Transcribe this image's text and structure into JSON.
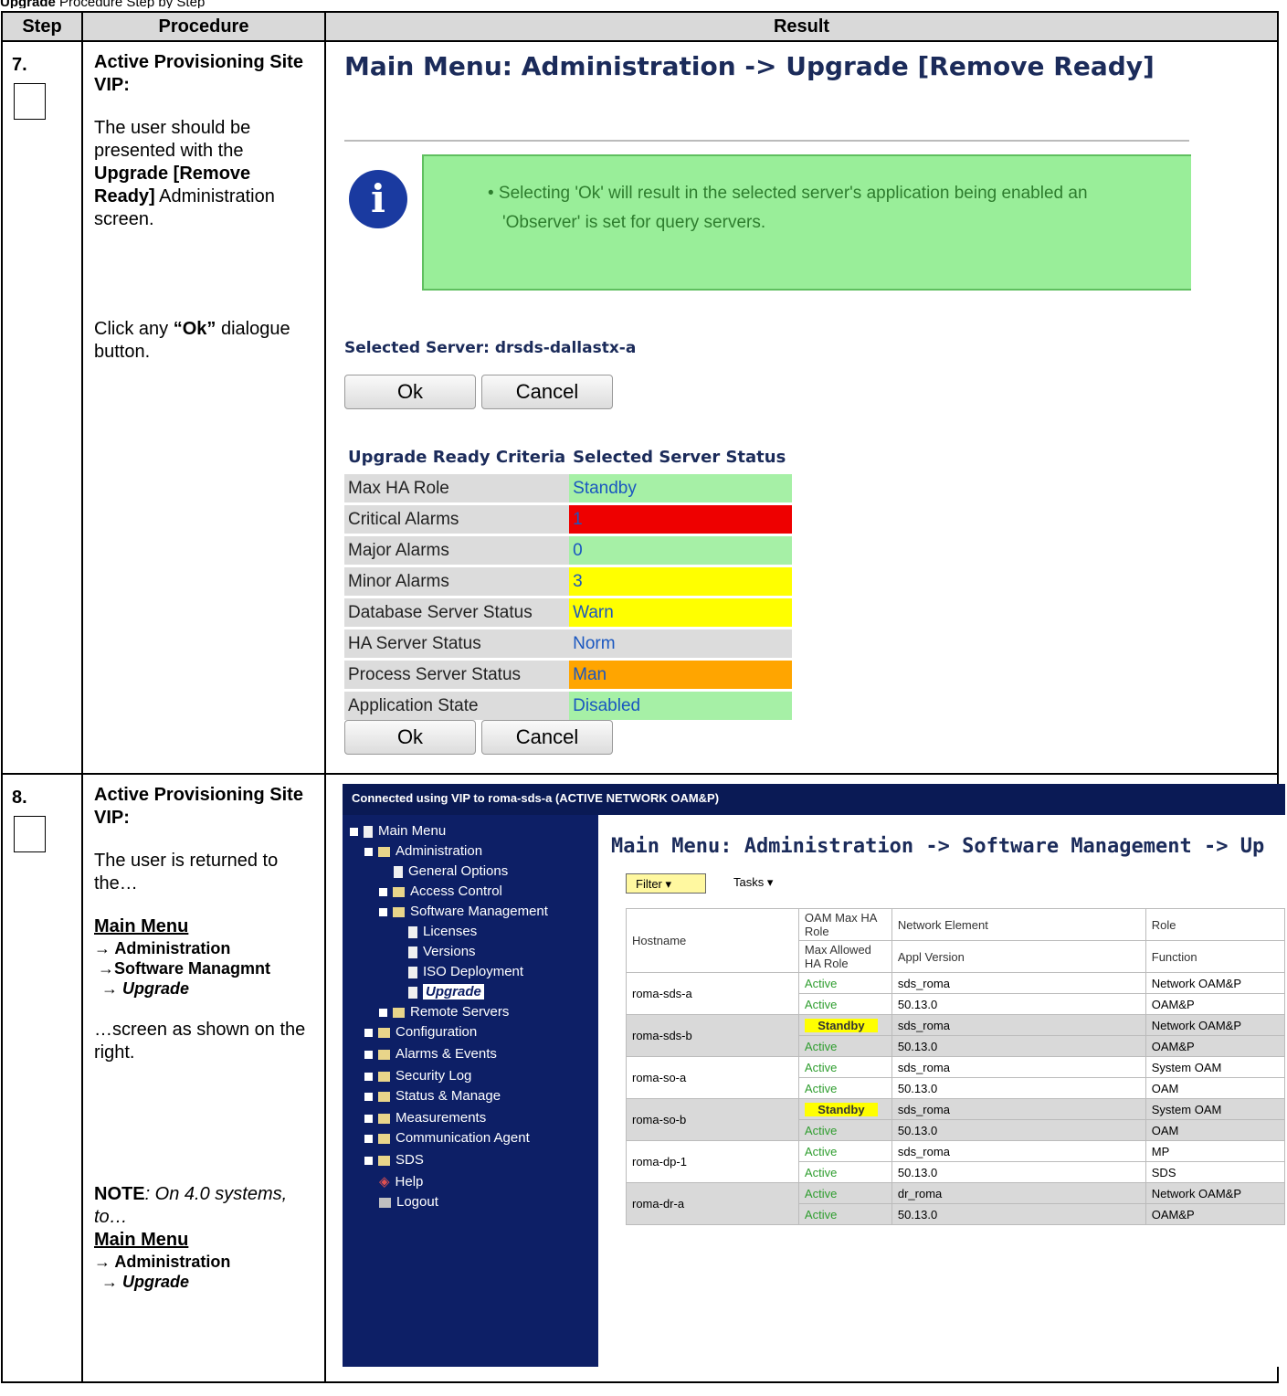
{
  "top_fragment": {
    "bold": "Upgrade",
    "rest": "Procedure Step by Step"
  },
  "headers": {
    "step": "Step",
    "procedure": "Procedure",
    "result": "Result"
  },
  "step7": {
    "number": "7.",
    "proc_heading": "Active Provisioning Site VIP:",
    "proc_p1_a": "The user should be presented with the ",
    "proc_p1_bold": "Upgrade [Remove Ready]",
    "proc_p1_b": " Administration screen.",
    "proc_p2_a": "Click any ",
    "proc_p2_bold": "“Ok”",
    "proc_p2_b": " dialogue button.",
    "title": "Main Menu: Administration -> Upgrade [Remove Ready]",
    "info_line1": "•  Selecting 'Ok' will result in the selected server's application being enabled an",
    "info_line2": "'Observer' is set for query servers.",
    "selected_server": "Selected Server: drsds-dallastx-a",
    "ok_label": "Ok",
    "cancel_label": "Cancel",
    "crit_header1": "Upgrade Ready Criteria",
    "crit_header2": "Selected Server Status",
    "criteria": [
      {
        "label": "Max HA Role",
        "value": "Standby",
        "color": "#a6f0a6"
      },
      {
        "label": "Critical Alarms",
        "value": "1",
        "color": "#ee0000"
      },
      {
        "label": "Major Alarms",
        "value": "0",
        "color": "#a6f0a6"
      },
      {
        "label": "Minor Alarms",
        "value": "3",
        "color": "#ffff00"
      },
      {
        "label": "Database Server Status",
        "value": "Warn",
        "color": "#ffff00"
      },
      {
        "label": "HA Server Status",
        "value": "Norm",
        "color": "#dcdcdc"
      },
      {
        "label": "Process Server Status",
        "value": "Man",
        "color": "#ffa500"
      },
      {
        "label": "Application State",
        "value": "Disabled",
        "color": "#a6f0a6"
      }
    ]
  },
  "step8": {
    "number": "8.",
    "proc_heading": "Active Provisioning Site VIP:",
    "proc_p1": "The user is returned to the…",
    "menu_main": "Main Menu",
    "menu_admin": "→ Administration",
    "menu_sw": "→Software Managmnt",
    "menu_upgrade": "→ Upgrade",
    "proc_p2": "…screen as shown on the right.",
    "note_bold": "NOTE",
    "note_rest": ": On 4.0 systems, to…",
    "note_menu_main": "Main Menu",
    "note_menu_admin": "→ Administration",
    "note_menu_upgrade": "→ Upgrade",
    "bar_text": "Connected using VIP to roma-sds-a (ACTIVE NETWORK OAM&P)",
    "nav": {
      "main_menu": "Main Menu",
      "administration": "Administration",
      "general_options": "General Options",
      "access_control": "Access Control",
      "software_management": "Software Management",
      "licenses": "Licenses",
      "versions": "Versions",
      "iso_deployment": "ISO Deployment",
      "upgrade": "Upgrade",
      "remote_servers": "Remote Servers",
      "configuration": "Configuration",
      "alarms_events": "Alarms & Events",
      "security_log": "Security Log",
      "status_manage": "Status & Manage",
      "measurements": "Measurements",
      "communication_agent": "Communication Agent",
      "sds": "SDS",
      "help": "Help",
      "logout": "Logout"
    },
    "screen_title": "Main Menu: Administration -> Software Management -> Up",
    "filter_label": "Filter",
    "tasks_label": "Tasks",
    "col_hostname": "Hostname",
    "col_oam_max": "OAM Max HA Role",
    "col_max_allowed": "Max Allowed HA Role",
    "col_ne": "Network Element",
    "col_appl": "Appl Version",
    "col_role": "Role",
    "col_function": "Function",
    "rows": [
      {
        "host": "roma-sds-a",
        "oam": "Active",
        "allowed": "Active",
        "ne": "sds_roma",
        "ver": "50.13.0",
        "role": "Network OAM&P",
        "func": "OAM&P"
      },
      {
        "host": "roma-sds-b",
        "oam": "Standby",
        "allowed": "Active",
        "ne": "sds_roma",
        "ver": "50.13.0",
        "role": "Network OAM&P",
        "func": "OAM&P"
      },
      {
        "host": "roma-so-a",
        "oam": "Active",
        "allowed": "Active",
        "ne": "sds_roma",
        "ver": "50.13.0",
        "role": "System OAM",
        "func": "OAM"
      },
      {
        "host": "roma-so-b",
        "oam": "Standby",
        "allowed": "Active",
        "ne": "sds_roma",
        "ver": "50.13.0",
        "role": "System OAM",
        "func": "OAM"
      },
      {
        "host": "roma-dp-1",
        "oam": "Active",
        "allowed": "Active",
        "ne": "sds_roma",
        "ver": "50.13.0",
        "role": "MP",
        "func": "SDS"
      },
      {
        "host": "roma-dr-a",
        "oam": "Active",
        "allowed": "Active",
        "ne": "dr_roma",
        "ver": "50.13.0",
        "role": "Network OAM&P",
        "func": "OAM&P"
      }
    ]
  }
}
